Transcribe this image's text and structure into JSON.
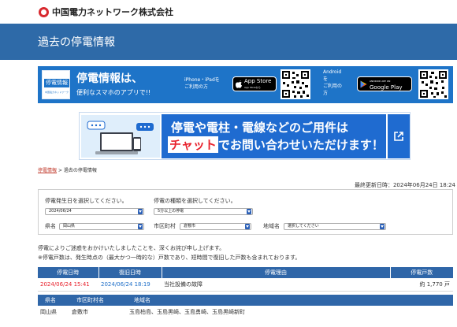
{
  "company": {
    "name": "中国電力ネットワーク株式会社"
  },
  "page_title": "過去の停電情報",
  "app_promo": {
    "badge_title": "停電情報",
    "badge_sub": "中国電力ネットワーク",
    "headline": "停電情報は、",
    "subline": "便利なスマホのアプリで!!",
    "ios_label": "iPhone・iPadを\nご利用の方",
    "appstore_small": "App Storeから",
    "appstore_big": "App Store",
    "android_label": "Android\nを\nご利用の\n方",
    "googleplay_small": "ANDROID APP ON",
    "googleplay_big": "Google Play"
  },
  "chat_banner": {
    "line1": "停電や電柱・電線などのご用件は",
    "highlight": "チャット",
    "line2_rest": "でお問い合わせいただけます！"
  },
  "breadcrumb": {
    "link": "停電情報",
    "separator": " > ",
    "current": "過去の停電情報"
  },
  "last_updated": "最終更新日時：2024年06月24日 18:24",
  "filters": {
    "date_label": "停電発生日を選択してください。",
    "date_value": "2024/06/24",
    "type_label": "停電の種類を選択してください。",
    "type_value": "5分以上の停電",
    "pref_label": "県名",
    "pref_value": "岡山県",
    "city_label": "市区町村",
    "city_value": "倉敷市",
    "area_label": "地域名",
    "area_value": "選択してください"
  },
  "notes": {
    "line1": "停電によりご迷惑をおかけいたしましたことを、深くお詫び申し上げます。",
    "line2": "※停電戸数は、発生時点の（最大かつ一時的な）戸数であり、短時間で復旧した戸数も含まれております。"
  },
  "outage_table": {
    "headers": [
      "停電日時",
      "復旧日時",
      "停電理由",
      "停電戸数"
    ],
    "row": {
      "start": "2024/06/24 15:41",
      "end": "2024/06/24 18:19",
      "reason": "当社設備の故障",
      "count": "約 1,770 戸"
    }
  },
  "area_table": {
    "headers": [
      "県名",
      "市区町村名",
      "地域名"
    ],
    "row": {
      "pref": "岡山県",
      "city": "倉敷市",
      "areas": "玉島柏島、玉島黒崎、玉島勇崎、玉島黒崎新町"
    }
  }
}
